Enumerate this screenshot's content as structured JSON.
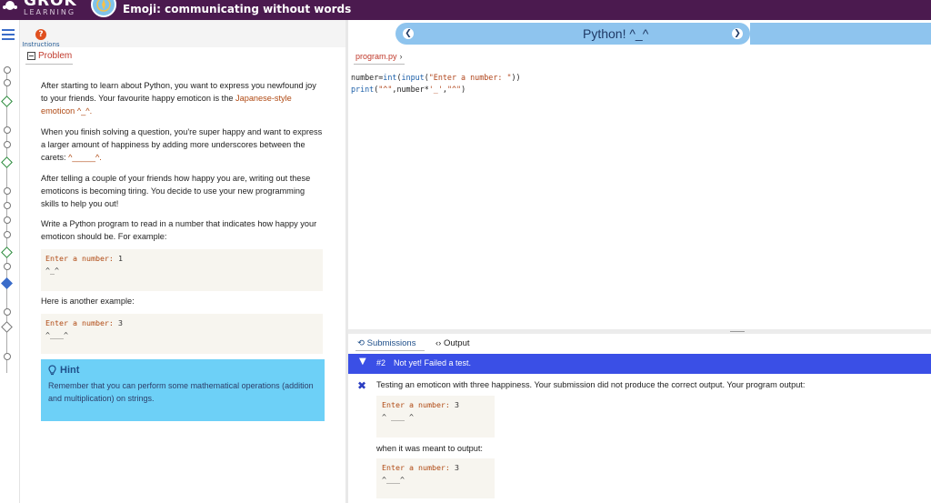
{
  "app": {
    "logo_text": "GROK",
    "logo_sub": "LEARNING",
    "course_title": "Emoji: communicating without words"
  },
  "instructions": {
    "label": "Instructions",
    "icon": "question-icon"
  },
  "problem": {
    "tab_label": "Problem",
    "p1_pre": "After starting to learn about Python, you want to express you newfound joy to your friends. Your favourite happy emoticon is the ",
    "p1_em": "Japanese-style emoticon ^_^.",
    "p2_pre": "When you finish solving a question, you're super happy and want to express a larger amount of happiness by adding more underscores between the carets: ",
    "p2_em": "^_____^.",
    "p3": "After telling a couple of your friends how happy you are, writing out these emoticons is becoming tiring. You decide to use your new programming skills to help you out!",
    "p4": "Write a Python program to read in a number that indicates how happy your emoticon should be. For example:",
    "example1_prompt": "Enter a number: ",
    "example1_input": "1",
    "example1_output": "^_^",
    "p5": "Here is another example:",
    "example2_prompt": "Enter a number: ",
    "example2_input": "3",
    "example2_output": "^___^"
  },
  "hint": {
    "title": "Hint",
    "body": "Remember that you can perform some mathematical operations (addition and multiplication) on strings."
  },
  "python_header": {
    "title": "Python! ^_^"
  },
  "editor": {
    "filename": "program.py",
    "line1_a": "number=",
    "line1_b": "int",
    "line1_c": "(",
    "line1_d": "input",
    "line1_e": "(",
    "line1_f": "\"Enter a number: \"",
    "line1_g": "))",
    "line2_a": "print",
    "line2_b": "(",
    "line2_c": "\"^\"",
    "line2_d": ",number*",
    "line2_e": "'_'",
    "line2_f": ",",
    "line2_g": "\"^\"",
    "line2_h": ")"
  },
  "results": {
    "tab_submissions": "Submissions",
    "tab_output": "Output",
    "submission_number": "#2",
    "submission_status": "Not yet! Failed a test.",
    "test_description": "Testing an emoticon with three happiness. Your submission did not produce the correct output. Your program output:",
    "actual_prompt": "Enter a number: ",
    "actual_input": "3",
    "actual_output": "^ ___ ^",
    "meant_text": "when it was meant to output:",
    "expected_prompt": "Enter a number: ",
    "expected_input": "3",
    "expected_output": "^___^"
  },
  "colors": {
    "topbar": "#4b1a4f",
    "hint_bg": "#6dd0f7",
    "python_pill": "#8ec4ee",
    "submission_bar": "#3a4fe6",
    "accent_orange": "#b04a14"
  }
}
